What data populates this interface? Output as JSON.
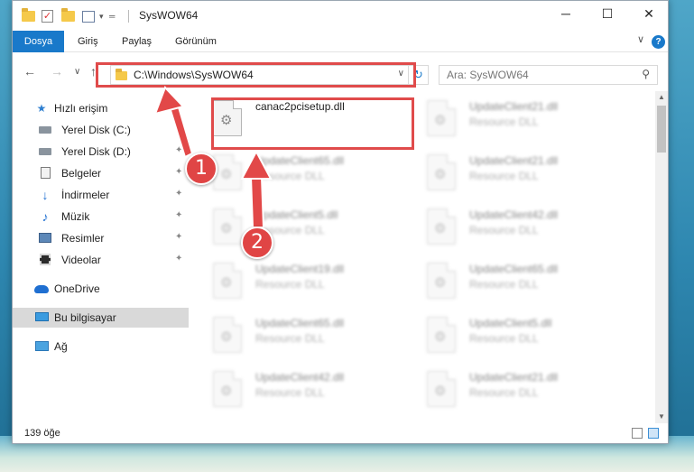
{
  "window": {
    "title": "SysWOW64",
    "minimize_label": "─",
    "maximize_label": "☐",
    "close_label": "✕"
  },
  "ribbon": {
    "tabs": [
      {
        "label": "Dosya"
      },
      {
        "label": "Giriş"
      },
      {
        "label": "Paylaş"
      },
      {
        "label": "Görünüm"
      }
    ],
    "help_label": "?",
    "collapse_label": "∨"
  },
  "nav": {
    "back_label": "←",
    "forward_label": "→",
    "recent_label": "∨",
    "up_label": "↑",
    "address": "C:\\Windows\\SysWOW64",
    "address_dropdown": "∨",
    "refresh_label": "↻",
    "search_placeholder": "Ara: SysWOW64",
    "search_icon": "⚲"
  },
  "navpane": {
    "items": [
      {
        "label": "Hızlı erişim",
        "icon": "star-icon",
        "glyph": "★",
        "color": "#2f7fd0",
        "pinned": false
      },
      {
        "label": "Yerel Disk (C:)",
        "icon": "drive-icon",
        "glyph": "",
        "pinned": true
      },
      {
        "label": "Yerel Disk (D:)",
        "icon": "drive-icon",
        "glyph": "",
        "pinned": true
      },
      {
        "label": "Belgeler",
        "icon": "documents-icon",
        "glyph": "",
        "pinned": true
      },
      {
        "label": "İndirmeler",
        "icon": "download-icon",
        "glyph": "↓",
        "color": "#1f6fd1",
        "pinned": true
      },
      {
        "label": "Müzik",
        "icon": "music-icon",
        "glyph": "♪",
        "color": "#1f6fd1",
        "pinned": true
      },
      {
        "label": "Resimler",
        "icon": "pictures-icon",
        "glyph": "",
        "pinned": true
      },
      {
        "label": "Videolar",
        "icon": "videos-icon",
        "glyph": "",
        "pinned": true
      },
      {
        "label": "OneDrive",
        "icon": "onedrive-icon",
        "glyph": ""
      },
      {
        "label": "Bu bilgisayar",
        "icon": "computer-icon",
        "glyph": "",
        "selected": true
      },
      {
        "label": "Ağ",
        "icon": "network-icon",
        "glyph": ""
      }
    ],
    "pin_glyph": "📌"
  },
  "files": [
    {
      "name": "canac2pcisetup.dll",
      "type": "",
      "blurred": false
    },
    {
      "name": "UpdateClient21.dll",
      "type": "Resource DLL",
      "blurred": true
    },
    {
      "name": "UpdateClient65.dll",
      "type": "Resource DLL",
      "blurred": true
    },
    {
      "name": "UpdateClient21.dll",
      "type": "Resource DLL",
      "blurred": true
    },
    {
      "name": "UpdateClient5.dll",
      "type": "Resource DLL",
      "blurred": true
    },
    {
      "name": "UpdateClient42.dll",
      "type": "Resource DLL",
      "blurred": true
    },
    {
      "name": "UpdateClient19.dll",
      "type": "Resource DLL",
      "blurred": true
    },
    {
      "name": "UpdateClient65.dll",
      "type": "Resource DLL",
      "blurred": true
    },
    {
      "name": "UpdateClient65.dll",
      "type": "Resource DLL",
      "blurred": true
    },
    {
      "name": "UpdateClient5.dll",
      "type": "Resource DLL",
      "blurred": true
    },
    {
      "name": "UpdateClient42.dll",
      "type": "Resource DLL",
      "blurred": true
    },
    {
      "name": "UpdateClient21.dll",
      "type": "Resource DLL",
      "blurred": true
    }
  ],
  "status": {
    "item_count": "139 öğe"
  },
  "annotations": {
    "badge1": "1",
    "badge2": "2",
    "accent": "#e04545"
  },
  "colors": {
    "file_tab": "#1979ca",
    "selection": "#d9d9d9"
  }
}
